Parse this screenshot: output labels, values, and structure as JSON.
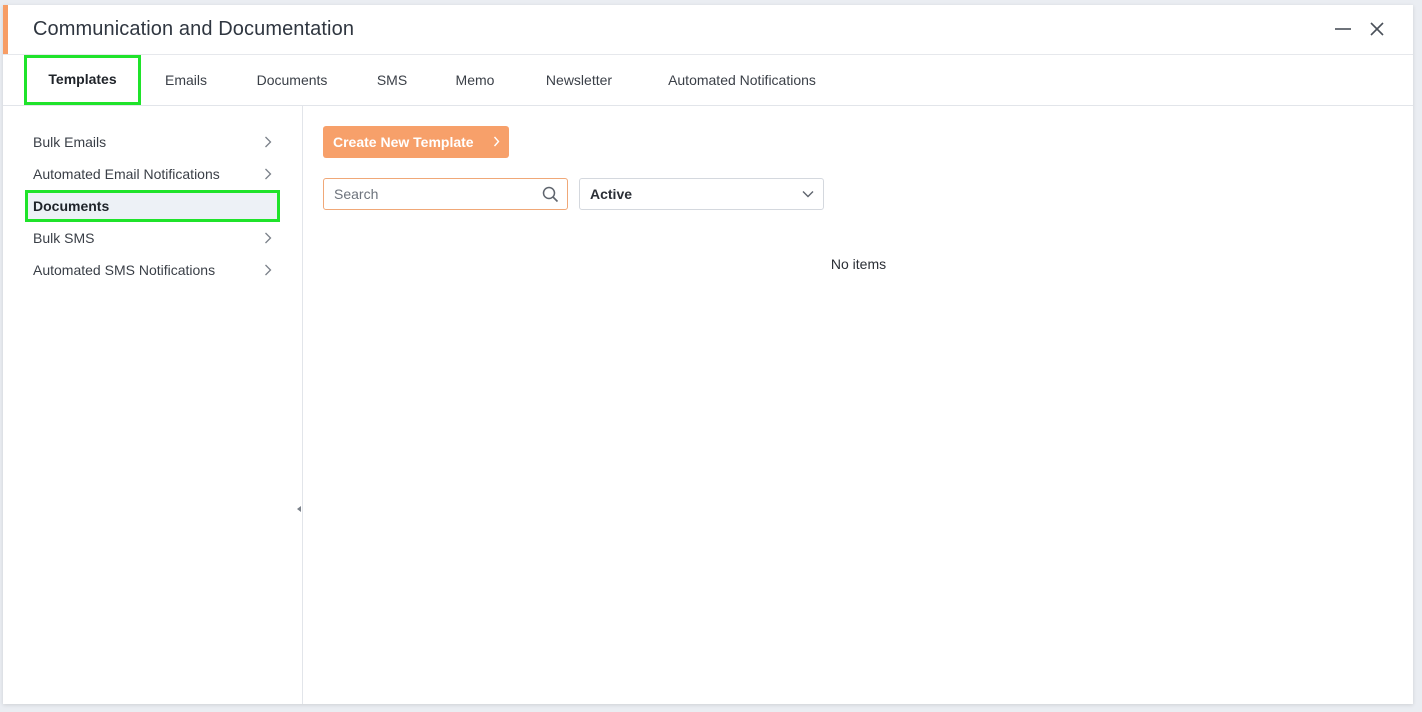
{
  "window": {
    "title": "Communication and Documentation",
    "accent_color": "#f79d65"
  },
  "tabs": [
    {
      "label": "Templates",
      "active": true
    },
    {
      "label": "Emails",
      "active": false
    },
    {
      "label": "Documents",
      "active": false
    },
    {
      "label": "SMS",
      "active": false
    },
    {
      "label": "Memo",
      "active": false
    },
    {
      "label": "Newsletter",
      "active": false
    },
    {
      "label": "Automated Notifications",
      "active": false
    }
  ],
  "sidebar": {
    "items": [
      {
        "label": "Bulk Emails",
        "has_chevron": true,
        "active": false
      },
      {
        "label": "Automated Email Notifications",
        "has_chevron": true,
        "active": false
      },
      {
        "label": "Documents",
        "has_chevron": false,
        "active": true
      },
      {
        "label": "Bulk SMS",
        "has_chevron": true,
        "active": false
      },
      {
        "label": "Automated SMS Notifications",
        "has_chevron": true,
        "active": false
      }
    ]
  },
  "main": {
    "create_button_label": "Create New Template",
    "search": {
      "placeholder": "Search",
      "value": ""
    },
    "status_filter": {
      "selected": "Active"
    },
    "empty_message": "No items"
  },
  "icons": {
    "minimize": "minimize-icon",
    "close": "close-icon",
    "chevron_right": "chevron-right-icon",
    "search": "search-icon",
    "chevron_down": "chevron-down-icon",
    "collapse": "collapse-left-icon"
  },
  "colors": {
    "brand_orange": "#f7a06a",
    "highlight_green": "#1fe32a",
    "active_bg": "#edf1f6"
  }
}
